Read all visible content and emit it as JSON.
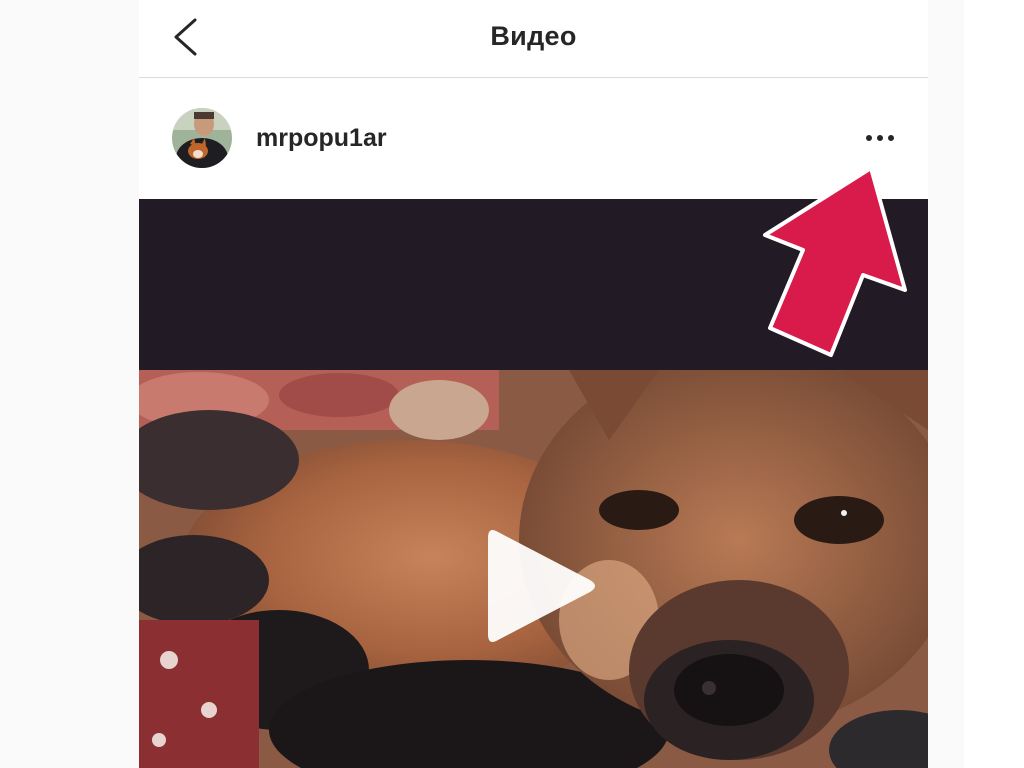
{
  "topbar": {
    "title": "Видео",
    "back_icon": "chevron-left-icon"
  },
  "post": {
    "username": "mrpopu1ar",
    "avatar_icon": "avatar",
    "more_icon": "more-horizontal-icon"
  },
  "media": {
    "type": "video",
    "play_icon": "play-icon"
  },
  "annotation": {
    "arrow_icon": "pointer-arrow-icon",
    "color": "#d81b4a"
  },
  "colors": {
    "text": "#262626",
    "border": "#dbdbdb",
    "background": "#fafafa",
    "media_bar": "#221a24"
  }
}
